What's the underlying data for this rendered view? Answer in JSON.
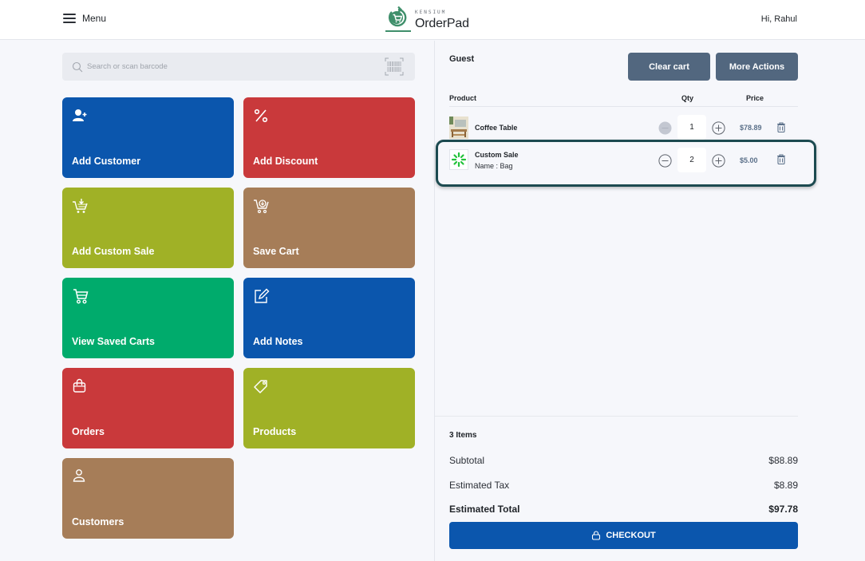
{
  "header": {
    "menu_label": "Menu",
    "brand_top": "KENSIUM",
    "brand_name": "OrderPad",
    "greeting": "Hi, Rahul",
    "brand_color": "#3f8f6b"
  },
  "search": {
    "placeholder": "Search or scan barcode",
    "value": "",
    "icon": "search-icon",
    "scan_icon": "barcode-icon"
  },
  "tiles": [
    {
      "label": "Add Customer",
      "icon": "add-user-icon",
      "color": "#0b56ad"
    },
    {
      "label": "Add Discount",
      "icon": "percent-icon",
      "color": "#c9393b"
    },
    {
      "label": "Add Custom Sale",
      "icon": "cart-add-icon",
      "color": "#a0b126"
    },
    {
      "label": "Save Cart",
      "icon": "cart-save-icon",
      "color": "#a67d58"
    },
    {
      "label": "View Saved Carts",
      "icon": "cart-icon",
      "color": "#00ab6c"
    },
    {
      "label": "Add Notes",
      "icon": "edit-note-icon",
      "color": "#0b56ad"
    },
    {
      "label": "Orders",
      "icon": "shopping-bag-icon",
      "color": "#c9393b"
    },
    {
      "label": "Products",
      "icon": "tag-icon",
      "color": "#a0b126"
    },
    {
      "label": "Customers",
      "icon": "user-icon",
      "color": "#a67d58"
    }
  ],
  "cart": {
    "customer": "Guest",
    "clear_label": "Clear cart",
    "more_label": "More Actions",
    "columns": {
      "product": "Product",
      "qty": "Qty",
      "price": "Price"
    },
    "items": [
      {
        "name": "Coffee Table",
        "sub": "",
        "qty": "1",
        "price": "$78.89",
        "thumb": "coffee-table-thumbnail",
        "minus_disabled": true
      },
      {
        "name": "Custom Sale",
        "sub": "Name : Bag",
        "qty": "2",
        "price": "$5.00",
        "thumb": "custom-sale-icon",
        "minus_disabled": false,
        "highlighted": true
      }
    ],
    "items_count": "3 Items",
    "subtotal_label": "Subtotal",
    "subtotal": "$88.89",
    "tax_label": "Estimated Tax",
    "tax": "$8.89",
    "total_label": "Estimated Total",
    "total": "$97.78",
    "checkout_label": "CHECKOUT",
    "highlight_color": "#1c4a50"
  }
}
